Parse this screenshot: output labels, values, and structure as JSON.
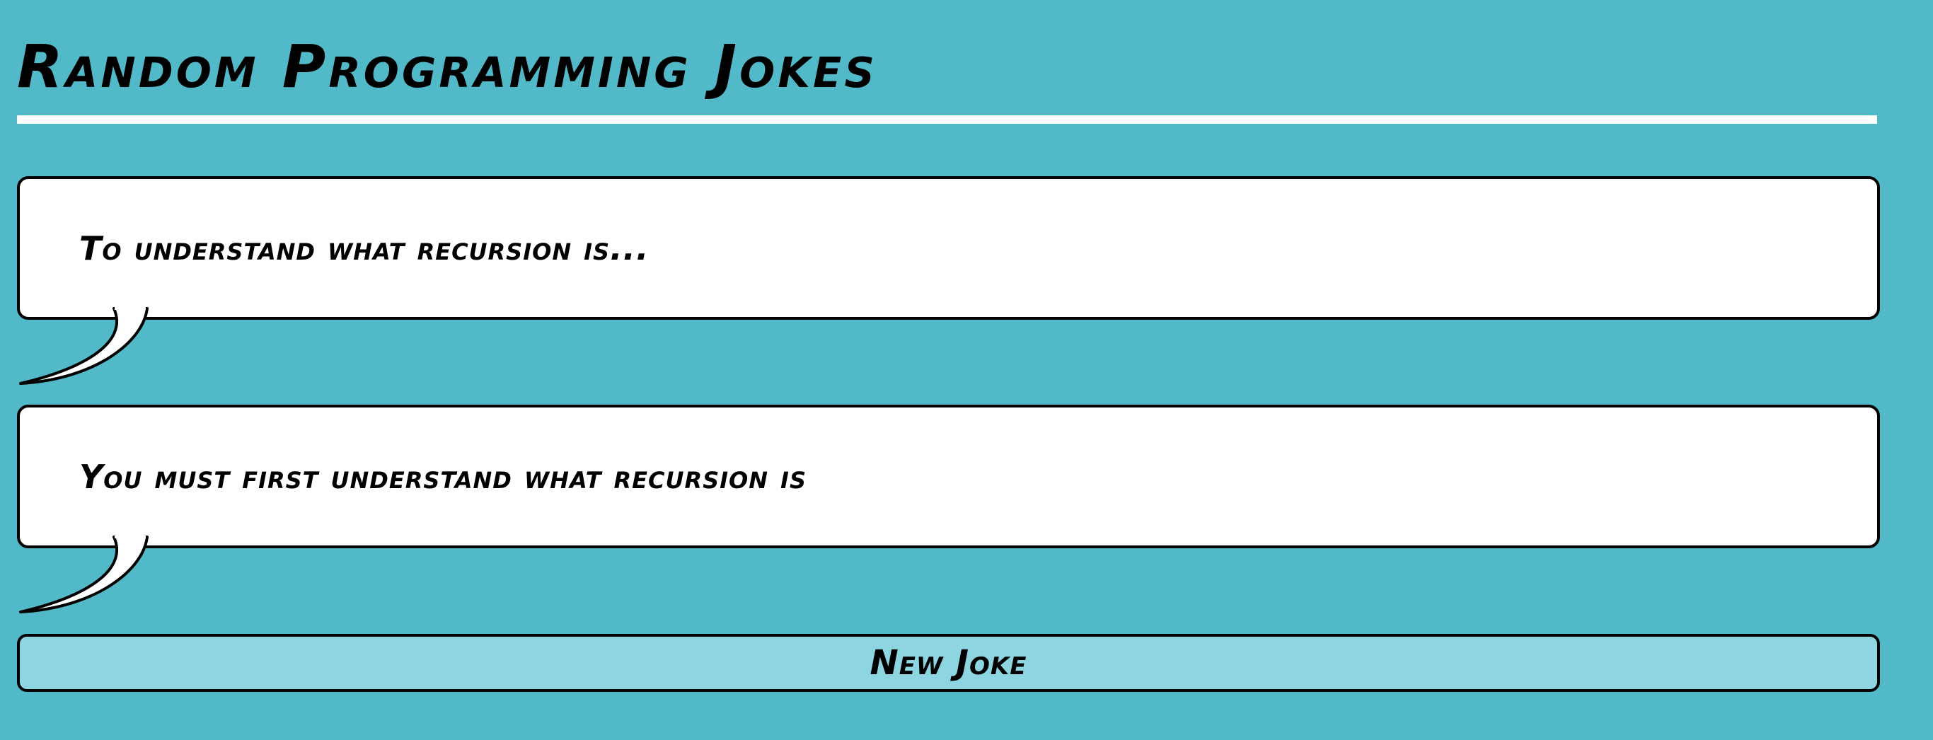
{
  "page": {
    "title": "Random Programming Jokes"
  },
  "joke": {
    "setup": "To understand what recursion is...",
    "punchline": "You must first understand what recursion is"
  },
  "actions": {
    "new_joke_label": "New Joke"
  },
  "colors": {
    "background": "#52b9c9",
    "bubble": "#ffffff",
    "button": "#8dd5e0",
    "rule": "#ffffff",
    "outline": "#000000"
  }
}
